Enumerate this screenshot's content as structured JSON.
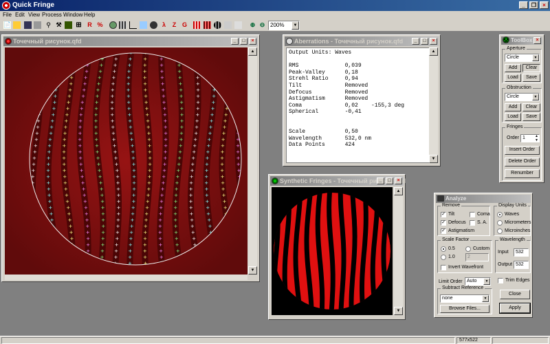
{
  "app": {
    "title": "Quick Fringe",
    "menu": [
      "File",
      "Edit",
      "View",
      "Process",
      "Window",
      "Help"
    ],
    "zoom": "200%",
    "status_size": "577x522"
  },
  "toolbar": {
    "buttons": [
      "new-icon",
      "open-icon",
      "save-icon",
      "print-icon",
      "magnify-icon",
      "tools-icon",
      "ruler-icon",
      "grid-icon",
      "r-icon",
      "percent-icon",
      "circle-icon",
      "fringe-icon",
      "chart-icon",
      "surface-icon",
      "disk-icon",
      "lambda-icon",
      "z-icon",
      "g-icon",
      "fringe2-icon",
      "fringe3-icon",
      "fringe4-icon",
      "fringe5-icon",
      "fringe6-icon",
      "zoom-in-icon",
      "zoom-out-icon"
    ],
    "labels": {
      "r": "R",
      "percent": "%",
      "lambda": "λ",
      "z": "Z",
      "g": "G"
    }
  },
  "main_window": {
    "title": "Точечный рисунок.qfd"
  },
  "aberrations": {
    "title": "Aberrations - Точечный рисунок.qfd",
    "units": "Output Units: Waves",
    "rows": [
      {
        "name": "RMS",
        "value": "0,039"
      },
      {
        "name": "Peak-Valley",
        "value": "0,18"
      },
      {
        "name": "Strehl Ratio",
        "value": "0,94"
      },
      {
        "name": "Tilt",
        "value": "Removed"
      },
      {
        "name": "Defocus",
        "value": "Removed"
      },
      {
        "name": "Astigmatism",
        "value": "Removed"
      },
      {
        "name": "Coma",
        "value": "0,02    -155,3 deg"
      },
      {
        "name": "Spherical",
        "value": "-0,41"
      }
    ],
    "rows2": [
      {
        "name": "Scale",
        "value": "0,50"
      },
      {
        "name": "Wavelength",
        "value": "532,0 nm"
      },
      {
        "name": "Data Points",
        "value": "424"
      }
    ]
  },
  "synthetic": {
    "title": "Synthetic Fringes - Точечный рисунок.qfd"
  },
  "toolbox": {
    "title": "ToolBox",
    "aperture": {
      "label": "Aperture",
      "shape": "Circle",
      "add": "Add",
      "clear": "Clear",
      "load": "Load",
      "save": "Save"
    },
    "obstruction": {
      "label": "Obstruction",
      "shape": "Circle",
      "add": "Add",
      "clear": "Clear",
      "load": "Load",
      "save": "Save"
    },
    "fringes": {
      "label": "Fringes",
      "order_label": "Order",
      "order": "1",
      "insert": "Insert Order",
      "delete": "Delete Order",
      "renumber": "Renumber"
    }
  },
  "analyze": {
    "title": "Analyze",
    "remove": {
      "label": "Remove",
      "tilt": "Tilt",
      "coma": "Coma",
      "defocus": "Defocus",
      "sa": "S. A.",
      "astig": "Astigmatism",
      "tilt_on": true,
      "coma_on": false,
      "defocus_on": true,
      "sa_on": false,
      "astig_on": true
    },
    "units": {
      "label": "Display Units",
      "waves": "Waves",
      "micrometers": "Micrometers",
      "microinches": "Microinches"
    },
    "scale": {
      "label": "Scale Factor",
      "half": "0.5",
      "one": "1.0",
      "custom": "Custom",
      "custom_value": "2",
      "invert": "Invert Wavefront"
    },
    "wavelength": {
      "label": "Wavelength",
      "input_label": "Input",
      "input": "532",
      "output_label": "Output",
      "output": "532"
    },
    "limit_label": "Limit Order",
    "limit": "Auto",
    "trim": "Trim Edges",
    "subtract": {
      "label": "Subtract Reference",
      "value": "none"
    },
    "browse": "Browse Files...",
    "close": "Close",
    "apply": "Apply"
  }
}
